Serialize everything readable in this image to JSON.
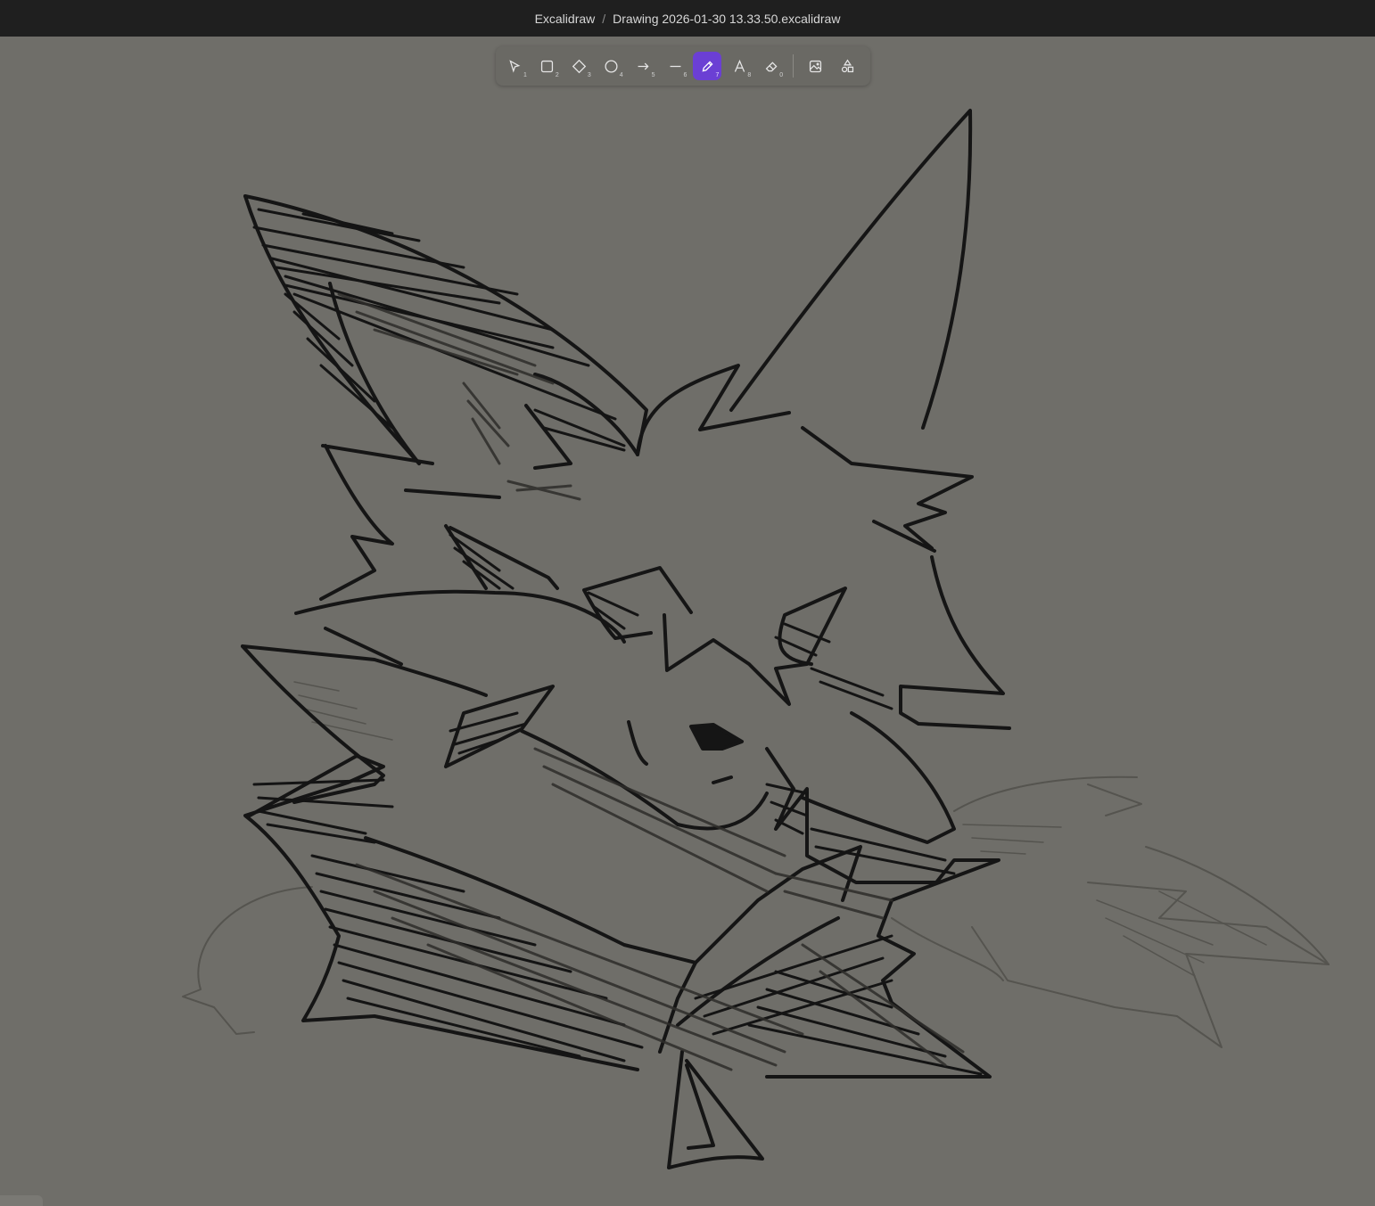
{
  "titlebar": {
    "app_name": "Excalidraw",
    "separator": "/",
    "file_name": "Drawing 2026-01-30 13.33.50.excalidraw"
  },
  "toolbar": {
    "active_tool": "freedraw",
    "tools": [
      {
        "name": "selection",
        "key": "1",
        "icon": "pointer-icon"
      },
      {
        "name": "rectangle",
        "key": "2",
        "icon": "rectangle-icon"
      },
      {
        "name": "diamond",
        "key": "3",
        "icon": "diamond-icon"
      },
      {
        "name": "ellipse",
        "key": "4",
        "icon": "ellipse-icon"
      },
      {
        "name": "arrow",
        "key": "5",
        "icon": "arrow-icon"
      },
      {
        "name": "line",
        "key": "6",
        "icon": "line-icon"
      },
      {
        "name": "freedraw",
        "key": "7",
        "icon": "pencil-icon"
      },
      {
        "name": "text",
        "key": "8",
        "icon": "text-icon"
      },
      {
        "name": "eraser",
        "key": "0",
        "icon": "eraser-icon"
      },
      {
        "name": "image",
        "key": "",
        "icon": "image-icon"
      },
      {
        "name": "library",
        "key": "",
        "icon": "shapes-library-icon"
      }
    ]
  },
  "colors": {
    "canvas_background": "#6f6e69",
    "titlebar_background": "#1f1f1f",
    "active_tool": "#6b3fd4",
    "stroke": "#1a1a1a"
  }
}
